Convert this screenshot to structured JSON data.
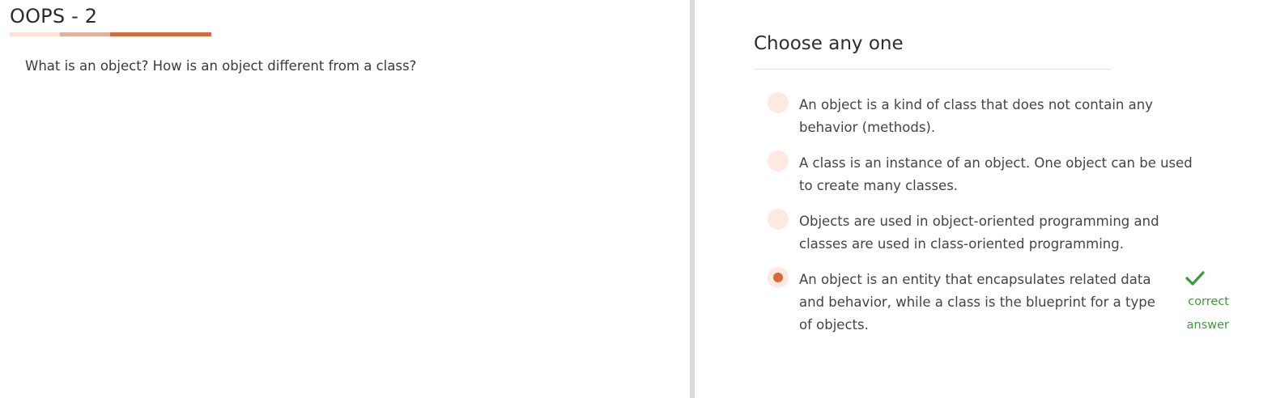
{
  "quiz": {
    "title": "OOPS - 2",
    "question": "What is an object? How is an object different from a class?"
  },
  "answer_panel": {
    "heading": "Choose any one",
    "options": [
      {
        "text": "An object is a kind of class that does not contain any behavior (methods).",
        "selected": false
      },
      {
        "text": "A class is an instance of an object. One object can be used to create many classes.",
        "selected": false
      },
      {
        "text": "Objects are used in object-oriented programming and classes are used in class-oriented programming.",
        "selected": false
      },
      {
        "text": "An object is an entity that encapsulates related data and behavior, while a class is the blueprint for a type of objects.",
        "selected": true
      }
    ],
    "feedback": {
      "label": "correct answer",
      "icon": "check-icon",
      "color": "#3a9b3a"
    }
  },
  "colors": {
    "accent": "#d9683a",
    "radio_background": "#fde9e1"
  }
}
